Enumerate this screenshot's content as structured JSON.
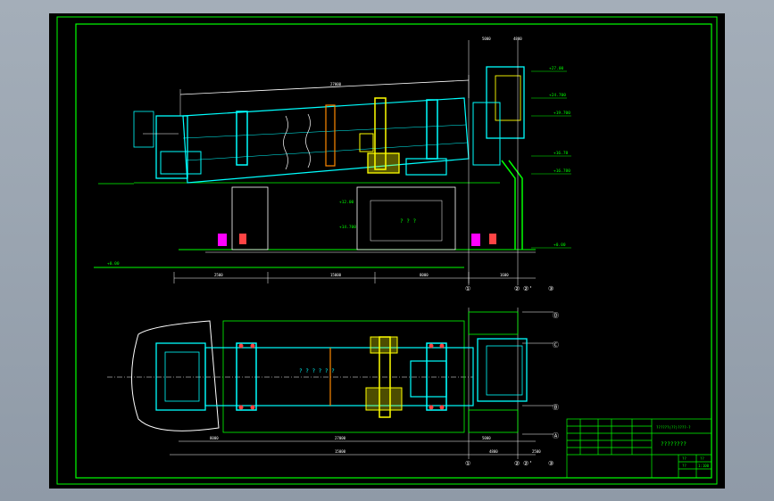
{
  "drawing": {
    "elevation_view": {
      "elevation_marks": [
        "+27.00",
        "+24.700",
        "+19.700",
        "+16.78",
        "+16.780",
        "+12.00",
        "+14.700",
        "+0.00",
        "+0.00"
      ],
      "center_label": "? ? ?",
      "axis_numbers": [
        "①",
        "②",
        "②'",
        "③"
      ],
      "dimension_texts": [
        "5000",
        "4800",
        "27000",
        "15000",
        "2500",
        "1600",
        "8000"
      ]
    },
    "plan_view": {
      "axis_letters": [
        "Ⓓ",
        "Ⓒ",
        "Ⓑ",
        "Ⓐ"
      ],
      "axis_numbers": [
        "①",
        "②",
        "②'",
        "③"
      ],
      "mid_label": "? ? ? ? ? ?",
      "dimension_texts": [
        "27000",
        "15000",
        "8000",
        "5000",
        "4800",
        "2500"
      ]
    },
    "title_block": {
      "project_title": "????????",
      "subtitle": "??????(??)????-?",
      "small_cells": [
        "??",
        "??",
        "??",
        "1:100"
      ]
    }
  },
  "colors": {
    "background": "#000000",
    "frame": "#00ff00",
    "equipment": "#00ffff",
    "detail": "#ffff00",
    "accent": "#ff00ff",
    "lines": "#ffffff",
    "warm": "#ff8800"
  }
}
